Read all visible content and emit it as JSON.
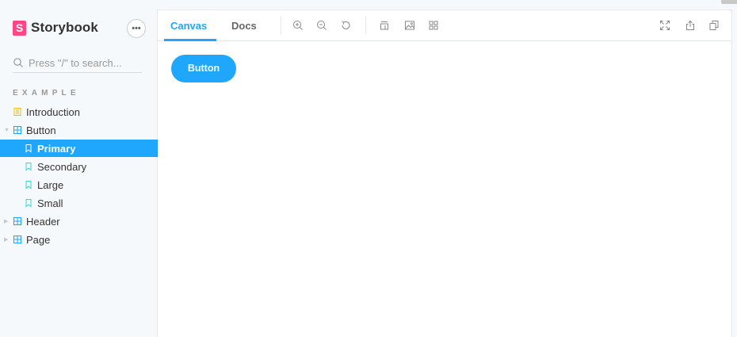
{
  "app": {
    "brand": "Storybook",
    "brand_logo_letter": "S",
    "menu_icon": "ellipsis-icon"
  },
  "search": {
    "placeholder": "Press \"/\" to search..."
  },
  "sidebar": {
    "section_title": "EXAMPLE",
    "items": [
      {
        "label": "Introduction",
        "icon": "document-icon",
        "level": 0,
        "selected": false
      },
      {
        "label": "Button",
        "icon": "component-icon",
        "level": 0,
        "expanded": true,
        "selected": false
      },
      {
        "label": "Primary",
        "icon": "bookmark-icon",
        "level": 1,
        "selected": true
      },
      {
        "label": "Secondary",
        "icon": "bookmark-icon",
        "level": 1,
        "selected": false
      },
      {
        "label": "Large",
        "icon": "bookmark-icon",
        "level": 1,
        "selected": false
      },
      {
        "label": "Small",
        "icon": "bookmark-icon",
        "level": 1,
        "selected": false
      },
      {
        "label": "Header",
        "icon": "component-icon",
        "level": 0,
        "expanded": false,
        "selected": false
      },
      {
        "label": "Page",
        "icon": "component-icon",
        "level": 0,
        "expanded": false,
        "selected": false
      }
    ]
  },
  "toolbar": {
    "tabs": [
      {
        "label": "Canvas",
        "active": true
      },
      {
        "label": "Docs",
        "active": false
      }
    ],
    "tools": [
      "zoom-in-icon",
      "zoom-out-icon",
      "zoom-reset-icon",
      "background-icon",
      "image-icon",
      "grid-icon"
    ],
    "right_tools": [
      "fullscreen-icon",
      "share-icon",
      "copy-icon"
    ]
  },
  "canvas": {
    "button_label": "Button"
  },
  "colors": {
    "accent": "#1EA7FD",
    "brand": "#FF4785",
    "doc_icon": "#F0B91A",
    "component_icon": "#1EA7FD",
    "story_icon": "#37D5D3"
  }
}
